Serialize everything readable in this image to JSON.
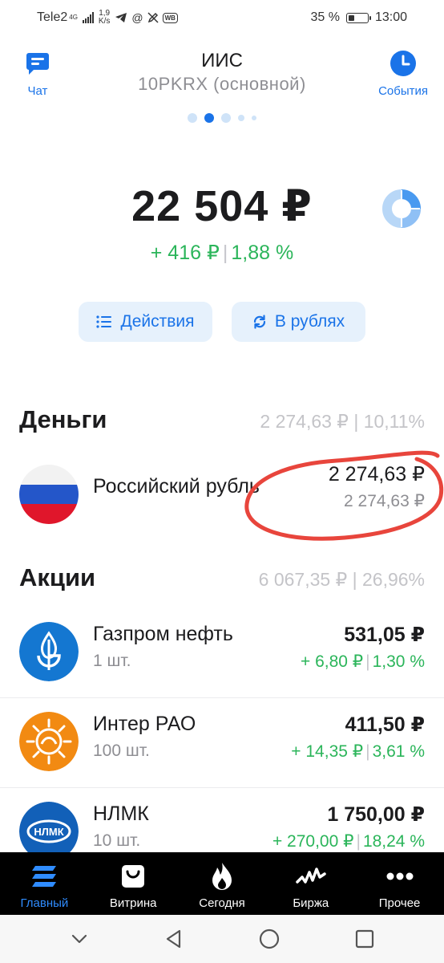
{
  "status_bar": {
    "carrier": "Tele2",
    "network": "4G",
    "speed_value": "1,9",
    "speed_unit": "K/s",
    "wb_badge": "WB",
    "battery_percent": "35 %",
    "battery_level": 0.35,
    "time": "13:00"
  },
  "header": {
    "chat_label": "Чат",
    "events_label": "События",
    "account_type": "ИИС",
    "account_id": "10PKRX  (основной)",
    "pager": {
      "count": 5,
      "active_index": 1
    }
  },
  "portfolio": {
    "total": "22 504 ₽",
    "change_abs": "+ 416 ₽",
    "change_pct": "1,88 %"
  },
  "actions": {
    "actions_label": "Действия",
    "currency_label": "В рублях"
  },
  "sections": {
    "money": {
      "title": "Деньги",
      "summary": "2 274,63 ₽ | 10,11%",
      "items": [
        {
          "name": "Российский рубль",
          "value": "2 274,63 ₽",
          "value2": "2 274,63 ₽"
        }
      ]
    },
    "stocks": {
      "title": "Акции",
      "summary": "6 067,35 ₽ | 26,96%",
      "items": [
        {
          "name": "Газпром нефть",
          "qty": "1 шт.",
          "value": "531,05 ₽",
          "change_abs": "+ 6,80 ₽",
          "change_pct": "1,30 %"
        },
        {
          "name": "Интер РАО",
          "qty": "100 шт.",
          "value": "411,50 ₽",
          "change_abs": "+ 14,35 ₽",
          "change_pct": "3,61 %"
        },
        {
          "name": "НЛМК",
          "qty": "10 шт.",
          "value": "1 750,00 ₽",
          "change_abs": "+ 270,00 ₽",
          "change_pct": "18,24 %",
          "logo_text": "НЛМК"
        }
      ]
    }
  },
  "bottom_nav": [
    {
      "label": "Главный",
      "icon": "home-stack-icon",
      "active": true
    },
    {
      "label": "Витрина",
      "icon": "shopping-bag-icon",
      "active": false
    },
    {
      "label": "Сегодня",
      "icon": "flame-icon",
      "active": false
    },
    {
      "label": "Биржа",
      "icon": "pulse-chart-icon",
      "active": false
    },
    {
      "label": "Прочее",
      "icon": "more-dots-icon",
      "active": false
    }
  ],
  "colors": {
    "accent": "#1a73e8",
    "positive": "#2bb55a",
    "annotation": "#e8453c",
    "nav_active": "#2f8cff"
  }
}
